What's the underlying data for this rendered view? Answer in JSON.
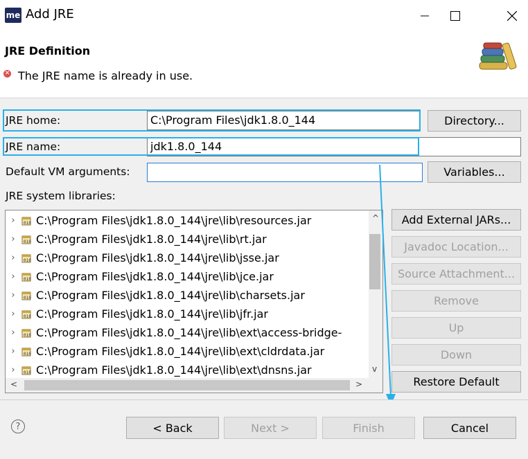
{
  "window": {
    "app_icon": "me",
    "title": "Add JRE",
    "icons": {
      "minimize": "minimize-icon",
      "maximize": "maximize-icon",
      "close": "close-icon"
    }
  },
  "header": {
    "title": "JRE Definition",
    "error_message": "The JRE name is already in use.",
    "error_icon": "error-icon",
    "banner_icon": "library-books-icon"
  },
  "form": {
    "jre_home": {
      "label": "JRE home:",
      "value": "C:\\Program Files\\jdk1.8.0_144",
      "button": "Directory..."
    },
    "jre_name": {
      "label": "JRE name:",
      "value": "jdk1.8.0_144"
    },
    "vm_args": {
      "label": "Default VM arguments:",
      "value": "",
      "button": "Variables..."
    },
    "libraries_label": "JRE system libraries:"
  },
  "libraries": [
    {
      "path": "C:\\Program Files\\jdk1.8.0_144\\jre\\lib\\resources.jar"
    },
    {
      "path": "C:\\Program Files\\jdk1.8.0_144\\jre\\lib\\rt.jar"
    },
    {
      "path": "C:\\Program Files\\jdk1.8.0_144\\jre\\lib\\jsse.jar"
    },
    {
      "path": "C:\\Program Files\\jdk1.8.0_144\\jre\\lib\\jce.jar"
    },
    {
      "path": "C:\\Program Files\\jdk1.8.0_144\\jre\\lib\\charsets.jar"
    },
    {
      "path": "C:\\Program Files\\jdk1.8.0_144\\jre\\lib\\jfr.jar"
    },
    {
      "path": "C:\\Program Files\\jdk1.8.0_144\\jre\\lib\\ext\\access-bridge-"
    },
    {
      "path": "C:\\Program Files\\jdk1.8.0_144\\jre\\lib\\ext\\cldrdata.jar"
    },
    {
      "path": "C:\\Program Files\\jdk1.8.0_144\\jre\\lib\\ext\\dnsns.jar"
    }
  ],
  "library_buttons": {
    "add_external": "Add External JARs...",
    "javadoc": "Javadoc Location...",
    "source": "Source Attachment...",
    "remove": "Remove",
    "up": "Up",
    "down": "Down",
    "restore": "Restore Default"
  },
  "footer": {
    "help_icon": "help-icon",
    "back": "< Back",
    "next": "Next >",
    "finish": "Finish",
    "cancel": "Cancel"
  },
  "colors": {
    "highlight": "#2ab0e8",
    "app_icon_bg": "#1e2b5c",
    "error": "#d9534f"
  }
}
